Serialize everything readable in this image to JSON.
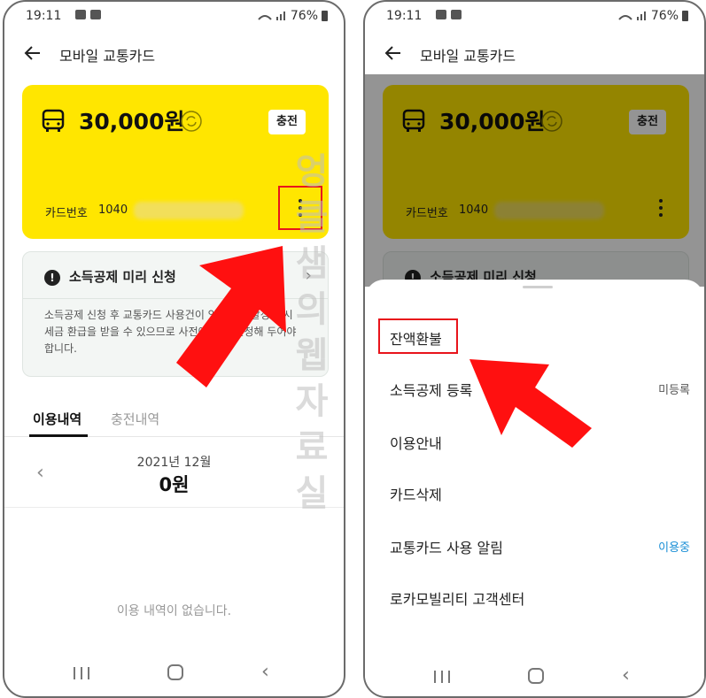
{
  "status": {
    "time": "19:11",
    "battery": "76%"
  },
  "left": {
    "appbar_title": "모바일 교통카드",
    "card": {
      "amount": "30,000원",
      "charge_label": "충전",
      "card_number_label": "카드번호",
      "card_number_prefix": "1040"
    },
    "notice": {
      "title": "소득공제 미리 신청",
      "body": "소득공제 신청 후 교통카드 사용건이 있으면 연말정산 시 세금 환급을 받을 수 있으므로 사전에 미리 신청해 두어야 합니다."
    },
    "tabs": {
      "usage": "이용내역",
      "charge": "충전내역"
    },
    "month": {
      "label": "2021년 12월",
      "amount": "0원"
    },
    "empty_text": "이용 내역이 없습니다."
  },
  "right": {
    "appbar_title": "모바일 교통카드",
    "card": {
      "amount": "30,000원",
      "charge_label": "충전",
      "card_number_label": "카드번호",
      "card_number_prefix": "1040"
    },
    "notice_title": "소득공제 미리 신청",
    "menu": [
      {
        "label": "잔액환불",
        "status": ""
      },
      {
        "label": "소득공제 등록",
        "status": "미등록"
      },
      {
        "label": "이용안내",
        "status": ""
      },
      {
        "label": "카드삭제",
        "status": ""
      },
      {
        "label": "교통카드 사용 알림",
        "status": "이용중"
      },
      {
        "label": "로카모빌리티 고객센터",
        "status": ""
      }
    ]
  },
  "watermark": "엉클샘의웹자료실",
  "colors": {
    "card_yellow": "#ffe600",
    "highlight_red": "#e8141b",
    "status_blue": "#1a8fd6"
  },
  "icons": [
    "back-arrow-icon",
    "bus-icon",
    "refresh-icon",
    "more-vertical-icon",
    "alert-icon",
    "chevron-right-icon",
    "chevron-left-icon"
  ]
}
